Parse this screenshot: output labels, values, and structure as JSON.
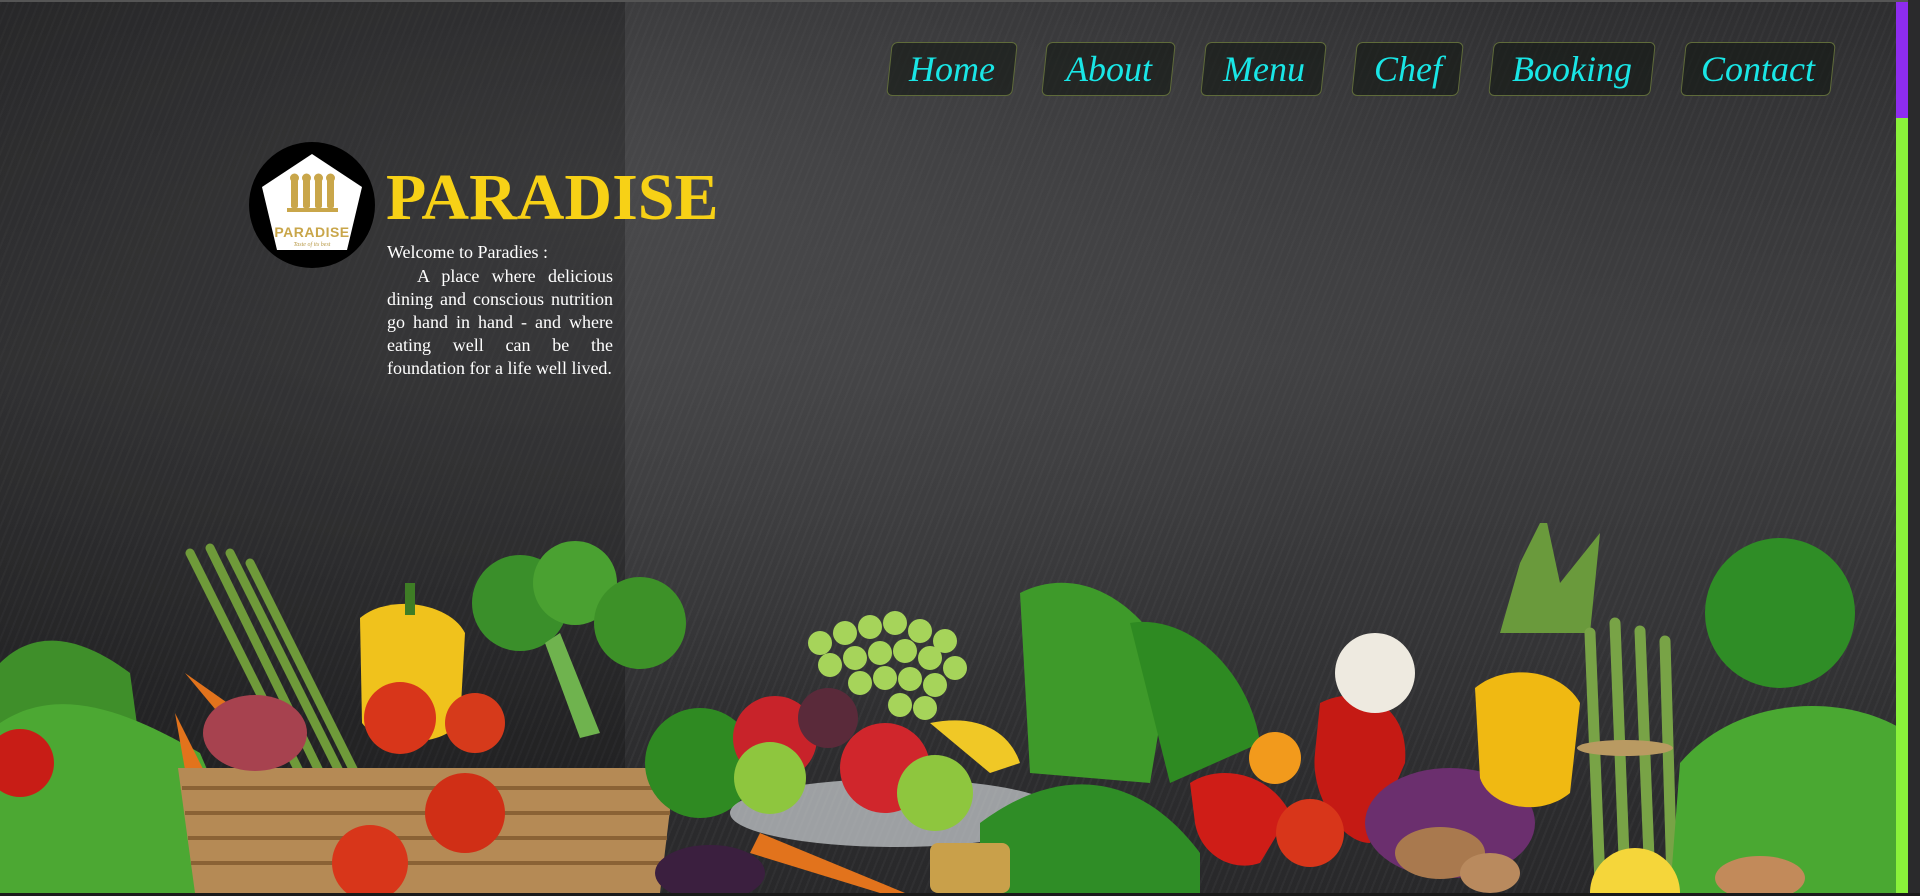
{
  "nav": {
    "items": [
      {
        "label": "Home"
      },
      {
        "label": "About"
      },
      {
        "label": "Menu"
      },
      {
        "label": "Chef"
      },
      {
        "label": "Booking"
      },
      {
        "label": "Contact"
      }
    ]
  },
  "logo": {
    "word": "PARADISE",
    "tagline": "Taste of its best"
  },
  "brand": {
    "title": "PARADISE"
  },
  "welcome": {
    "heading": "Welcome to Paradies :",
    "body": "A place where delicious dining and conscious nutrition go hand in hand - and where eating well can be the foundation for a life well lived."
  },
  "colors": {
    "nav_text": "#19e6e6",
    "brand_title": "#f7d116",
    "scrollbar_top": "#8e2cf0",
    "scrollbar_bottom": "#8af23a"
  },
  "icons": [
    "logo-fork-spoon-icon"
  ]
}
